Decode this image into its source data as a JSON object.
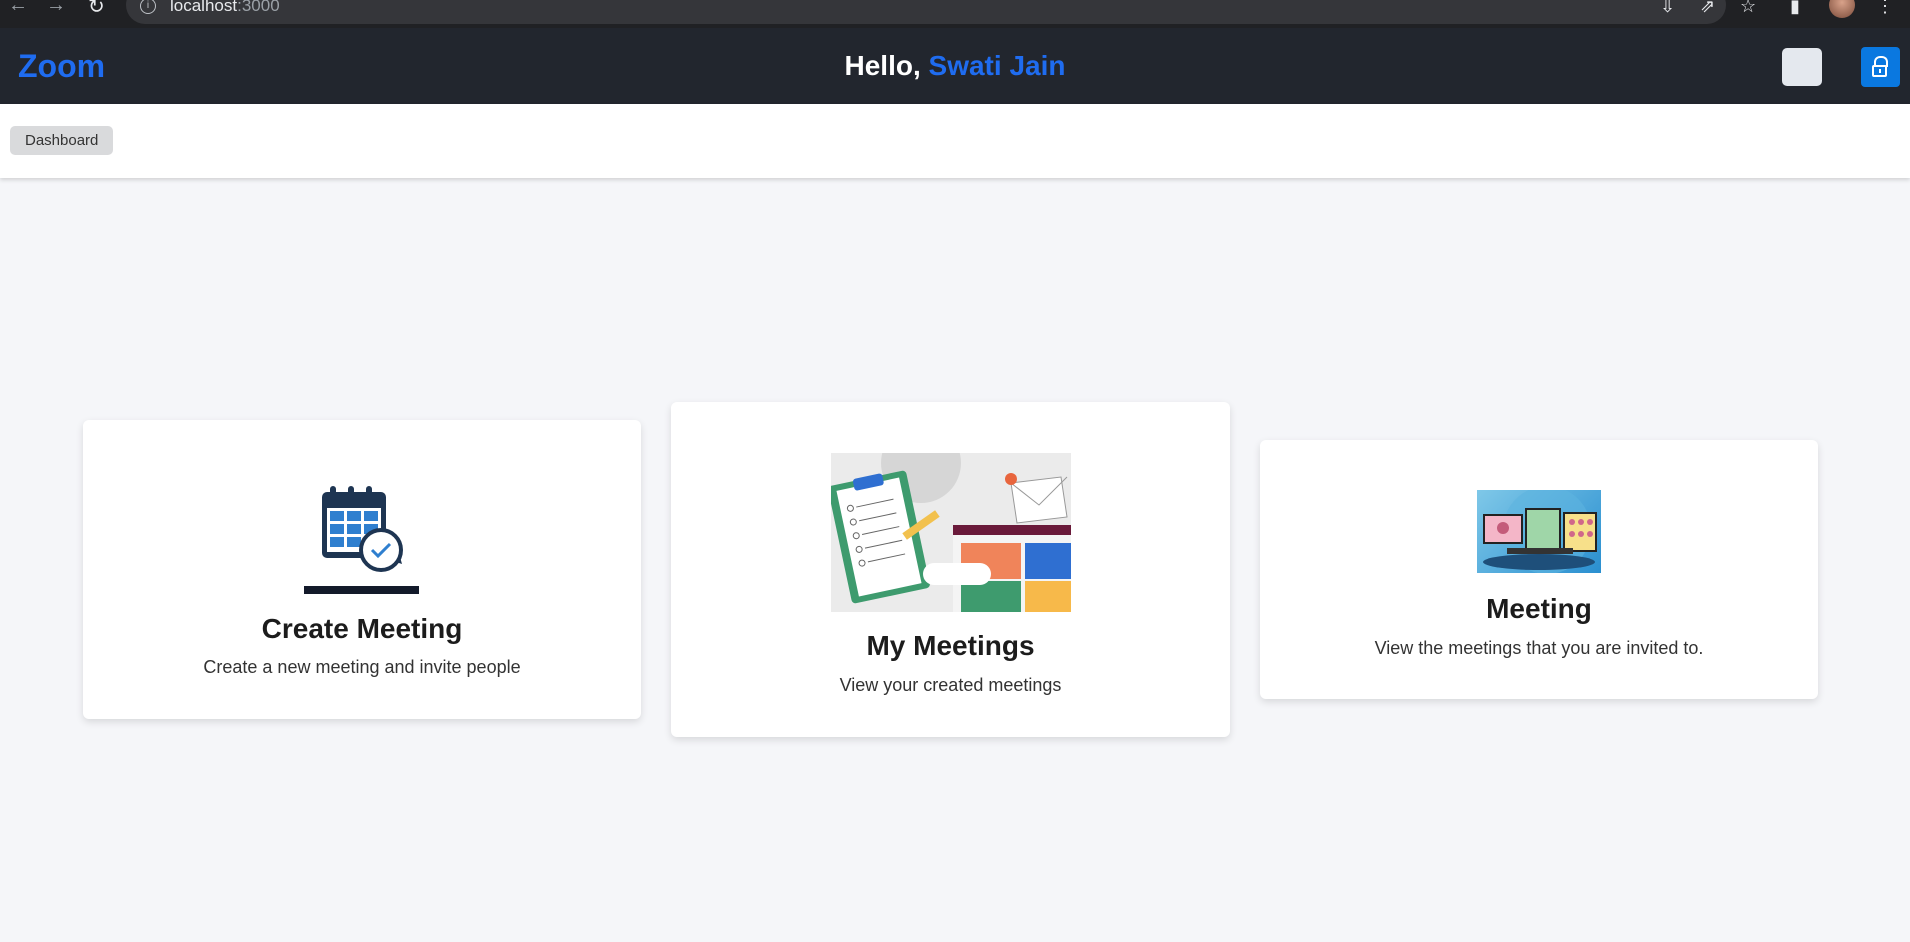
{
  "browser": {
    "url_host": "localhost",
    "url_port": ":3000"
  },
  "header": {
    "logo": "Zoom",
    "greeting_prefix": "Hello, ",
    "user_name": "Swati Jain"
  },
  "breadcrumb": {
    "items": [
      "Dashboard"
    ]
  },
  "cards": [
    {
      "title": "Create Meeting",
      "description": "Create a new meeting and invite people",
      "icon": "calendar-clock-icon"
    },
    {
      "title": "My Meetings",
      "description": "View your created meetings",
      "icon": "checklist-illustration"
    },
    {
      "title": "Meeting",
      "description": "View the meetings that you are invited to.",
      "icon": "video-call-devices-illustration"
    }
  ],
  "colors": {
    "header_bg": "#22262e",
    "accent": "#1f6cf0",
    "lock_button": "#0a78e0",
    "page_bg": "#f5f6f9"
  }
}
